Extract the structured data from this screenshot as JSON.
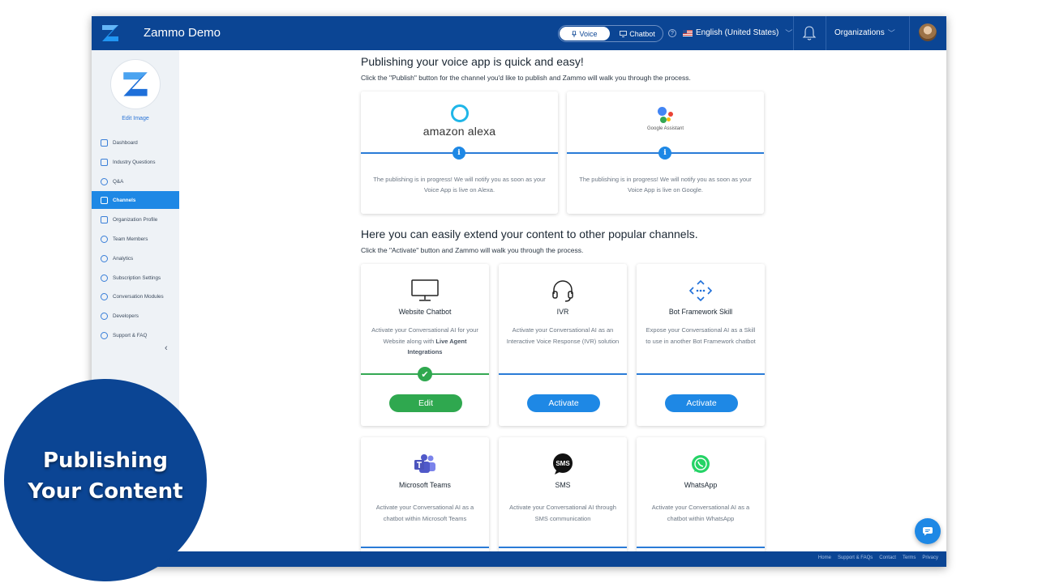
{
  "header": {
    "app_title": "Zammo Demo",
    "mode_voice": "Voice",
    "mode_chatbot": "Chatbot",
    "language": "English (United States)",
    "organizations": "Organizations"
  },
  "sidebar": {
    "edit_image": "Edit Image",
    "items": [
      {
        "label": "Dashboard"
      },
      {
        "label": "Industry Questions"
      },
      {
        "label": "Q&A"
      },
      {
        "label": "Channels"
      },
      {
        "label": "Organization Profile"
      },
      {
        "label": "Team Members"
      },
      {
        "label": "Analytics"
      },
      {
        "label": "Subscription Settings"
      },
      {
        "label": "Conversation Modules"
      },
      {
        "label": "Developers"
      },
      {
        "label": "Support & FAQ"
      }
    ],
    "active": "Channels"
  },
  "publish": {
    "heading": "Publishing your voice app is quick and easy!",
    "subheading": "Click the \"Publish\" button for the channel you'd like to publish and Zammo will walk you through the process.",
    "cards": [
      {
        "logo_text": "amazon alexa",
        "message": "The publishing is in progress! We will notify you as soon as your Voice App is live on Alexa."
      },
      {
        "logo_text": "Google Assistant",
        "message": "The publishing is in progress!  We will notify you as soon as your Voice App is live on Google."
      }
    ]
  },
  "extend": {
    "heading": "Here you can easily extend your content to other popular channels.",
    "subheading": "Click the \"Activate\" button and Zammo will walk you through the process.",
    "channels": [
      {
        "title": "Website Chatbot",
        "desc_pre": "Activate your Conversational AI for your Website along with ",
        "desc_bold": "Live Agent Integrations",
        "button": "Edit",
        "status": "active"
      },
      {
        "title": "IVR",
        "desc": "Activate your Conversational AI as an Interactive Voice Response (IVR) solution",
        "button": "Activate"
      },
      {
        "title": "Bot Framework Skill",
        "desc": "Expose your Conversational AI as a Skill to use in another Bot Framework chatbot",
        "button": "Activate"
      },
      {
        "title": "Microsoft Teams",
        "desc": "Activate your Conversational AI as a chatbot within Microsoft Teams"
      },
      {
        "title": "SMS",
        "desc": "Activate your Conversational AI through SMS communication",
        "icon_text": "SMS"
      },
      {
        "title": "WhatsApp",
        "desc": "Activate your Conversational AI as a chatbot within WhatsApp"
      }
    ]
  },
  "footer": {
    "links": [
      "Home",
      "Support & FAQs",
      "Contact",
      "Terms",
      "Privacy"
    ]
  },
  "overlay": {
    "line1": "Publishing",
    "line2": "Your Content"
  },
  "colors": {
    "brand": "#0b4594",
    "accent": "#1e88e5",
    "success": "#2fa84f"
  }
}
